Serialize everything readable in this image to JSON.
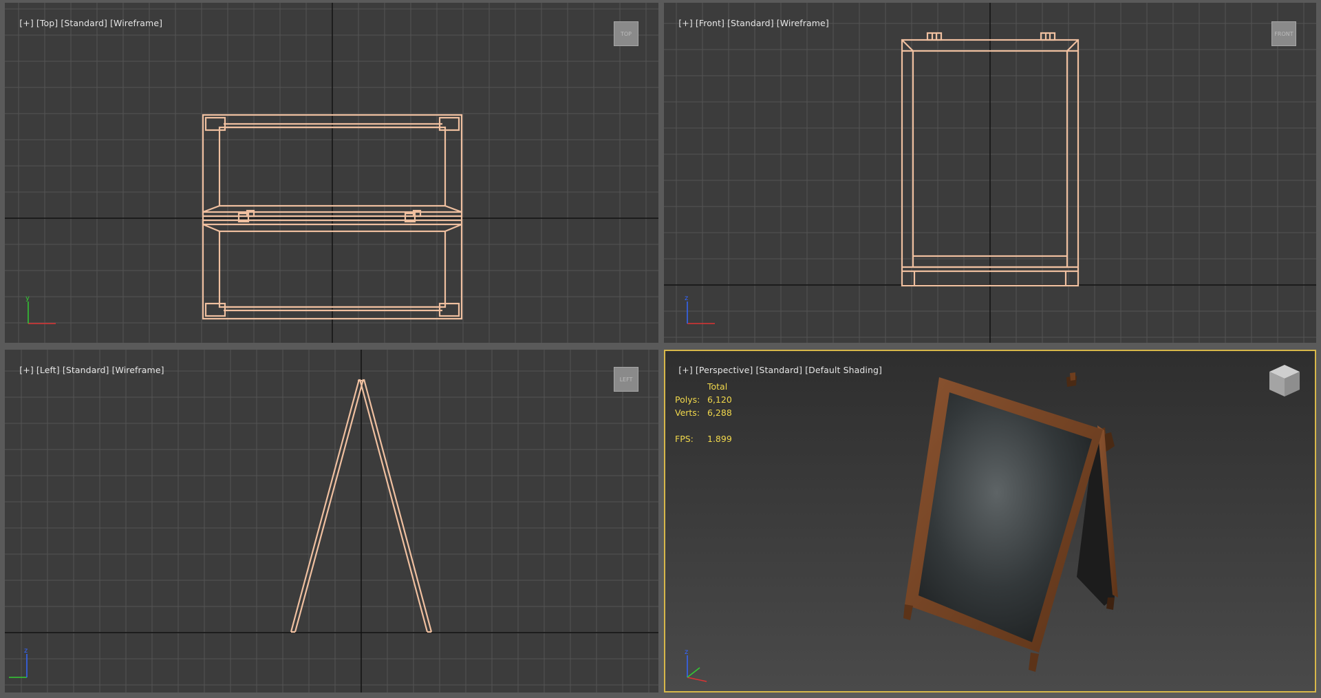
{
  "viewports": {
    "top": {
      "labels": [
        "[+]",
        "[Top]",
        "[Standard]",
        "[Wireframe]"
      ],
      "cube": "TOP"
    },
    "front": {
      "labels": [
        "[+]",
        "[Front]",
        "[Standard]",
        "[Wireframe]"
      ],
      "cube": "FRONT"
    },
    "left": {
      "labels": [
        "[+]",
        "[Left]",
        "[Standard]",
        "[Wireframe]"
      ],
      "cube": "LEFT"
    },
    "persp": {
      "labels": [
        "[+]",
        "[Perspective]",
        "[Standard]",
        "[Default Shading]"
      ]
    }
  },
  "stats": {
    "total_label": "Total",
    "polys_label": "Polys:",
    "polys_value": "6,120",
    "verts_label": "Verts:",
    "verts_value": "6,288",
    "fps_label": "FPS:",
    "fps_value": "1.899"
  },
  "axes": {
    "x": "x",
    "y": "y",
    "z": "z"
  },
  "colors": {
    "viewport_bg": "#3c3c3c",
    "grid": "#545454",
    "wire": "#f0c0a0",
    "stats_text": "#f2d94c",
    "active_border": "#d8b84a",
    "wood": "#6e3e1e",
    "chalk": "#2a2d2f"
  }
}
